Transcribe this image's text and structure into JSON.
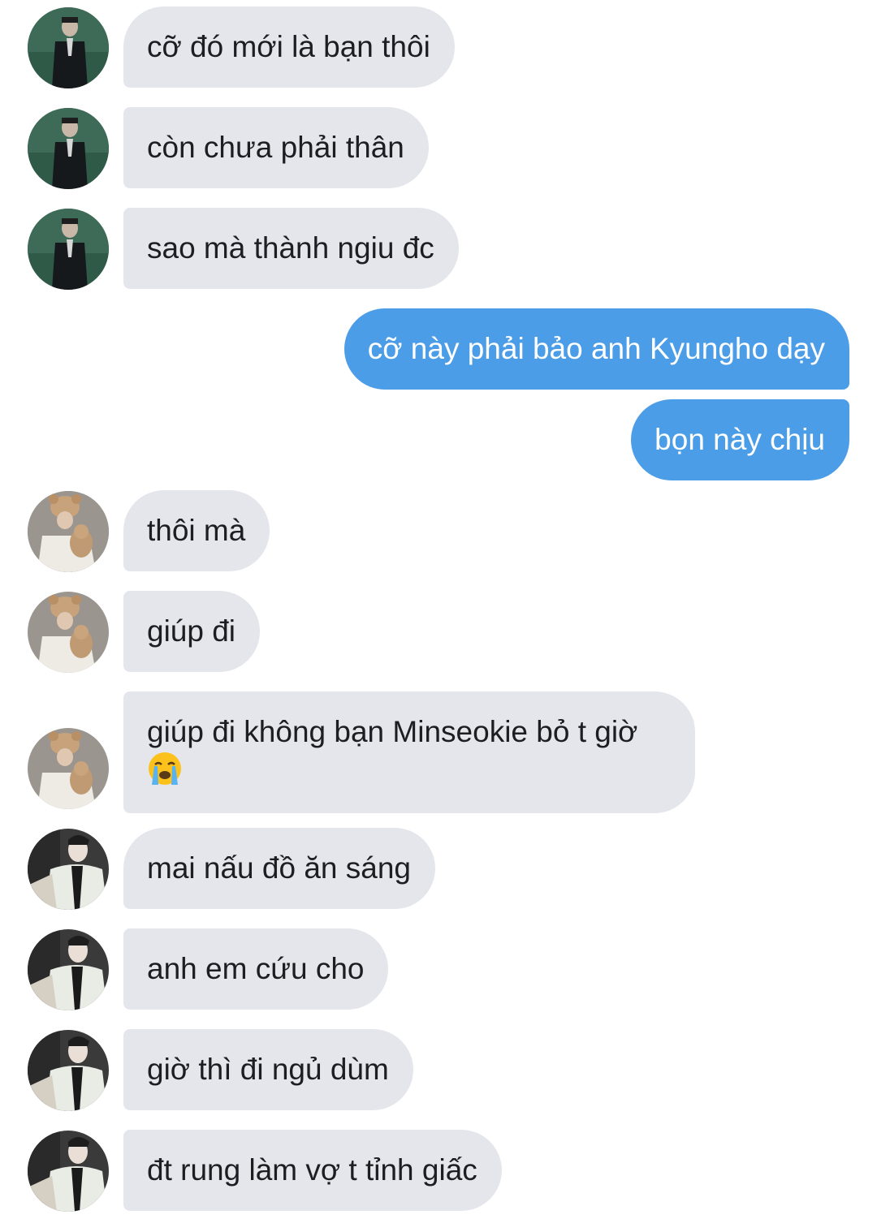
{
  "messages": [
    {
      "side": "in",
      "avatar": "suit-man-avatar",
      "text": "cỡ đó mới là bạn thôi"
    },
    {
      "side": "in",
      "avatar": "suit-man-avatar",
      "text": "còn chưa phải thân"
    },
    {
      "side": "in",
      "avatar": "suit-man-avatar",
      "text": "sao mà thành ngiu đc"
    },
    {
      "side": "out",
      "text": "cỡ này phải bảo anh Kyungho dạy"
    },
    {
      "side": "out",
      "text": "bọn này chịu"
    },
    {
      "side": "in",
      "avatar": "bear-hat-avatar",
      "text": "thôi mà"
    },
    {
      "side": "in",
      "avatar": "bear-hat-avatar",
      "text": "giúp đi"
    },
    {
      "side": "in",
      "avatar": "bear-hat-avatar",
      "text": "giúp đi không bạn Minseokie bỏ t giờ",
      "emoji": "loudly-crying-face-emoji"
    },
    {
      "side": "in",
      "avatar": "cardigan-man-avatar",
      "text": "mai nấu đồ ăn sáng"
    },
    {
      "side": "in",
      "avatar": "cardigan-man-avatar",
      "text": "anh em cứu cho"
    },
    {
      "side": "in",
      "avatar": "cardigan-man-avatar",
      "text": "giờ thì đi ngủ dùm"
    },
    {
      "side": "in",
      "avatar": "cardigan-man-avatar",
      "text": "đt rung làm vợ t tỉnh giấc"
    }
  ],
  "colors": {
    "incoming_bubble": "#e4e6eb",
    "outgoing_bubble": "#4c9de8",
    "outgoing_text": "#ffffff",
    "incoming_text": "#1c1e21"
  }
}
